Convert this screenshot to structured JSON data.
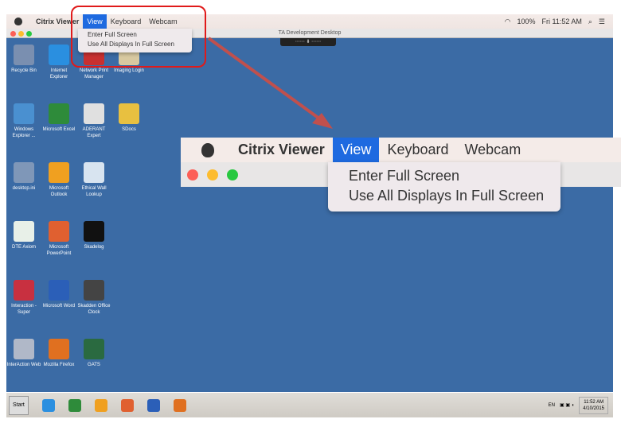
{
  "menubar": {
    "app": "Citrix Viewer",
    "items": [
      "View",
      "Keyboard",
      "Webcam"
    ],
    "battery": "100%",
    "clock": "Fri 11:52 AM"
  },
  "window": {
    "title": "TA Development Desktop"
  },
  "view_menu": {
    "items": [
      "Enter Full Screen",
      "Use All Displays In Full Screen"
    ]
  },
  "desktop_icons": [
    {
      "label": "Recycle Bin",
      "color": "#7a8fb0"
    },
    {
      "label": "Internet Explorer",
      "color": "#2a8fe0"
    },
    {
      "label": "Network Print Manager",
      "color": "#c83030"
    },
    {
      "label": "Imaging Login",
      "color": "#d8c9a0"
    },
    {
      "label": "Windows Explorer ...",
      "color": "#4a90d0"
    },
    {
      "label": "Microsoft Excel",
      "color": "#2e8b3a"
    },
    {
      "label": "ADERANT Expert",
      "color": "#e0e0e0"
    },
    {
      "label": "SDocs",
      "color": "#e8c040"
    },
    {
      "label": "desktop.ini",
      "color": "#7f97b8"
    },
    {
      "label": "Microsoft Outlook",
      "color": "#f0a020"
    },
    {
      "label": "Ethical Wall Lookup",
      "color": "#d8e4f0"
    },
    {
      "label": "DTE Axiom",
      "color": "#e8f0e8"
    },
    {
      "label": "Microsoft PowerPoint",
      "color": "#e06030"
    },
    {
      "label": "Skadelog",
      "color": "#111111"
    },
    {
      "label": "Interaction - Super",
      "color": "#c83040"
    },
    {
      "label": "Microsoft Word",
      "color": "#2b5fb8"
    },
    {
      "label": "Skadden Office Clock",
      "color": "#444444"
    },
    {
      "label": "InterAction Web",
      "color": "#b0b8c8"
    },
    {
      "label": "Mozilla Firefox",
      "color": "#e07020"
    },
    {
      "label": "GATS",
      "color": "#2a6a40"
    }
  ],
  "taskbar": {
    "start": "Start",
    "pinned": [
      "internet-explorer",
      "excel",
      "outlook",
      "powerpoint",
      "word",
      "firefox"
    ],
    "pinned_colors": [
      "#2a8fe0",
      "#2e8b3a",
      "#f0a020",
      "#e06030",
      "#2b5fb8",
      "#e07020"
    ],
    "lang": "EN",
    "time": "11:52 AM",
    "date": "4/10/2015"
  },
  "colors": {
    "desktop": "#3b6ba5",
    "highlight": "#1e6ae0",
    "annotation": "#e01a1a",
    "arrow": "#c0504d"
  }
}
